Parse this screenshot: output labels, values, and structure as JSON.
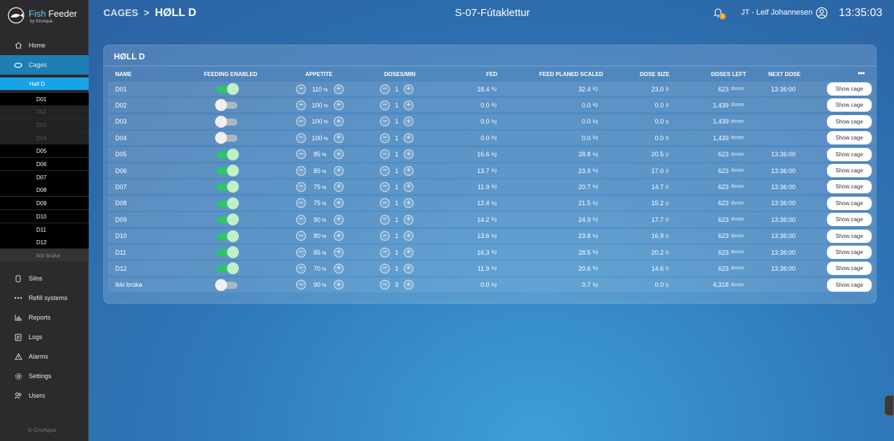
{
  "app": {
    "brand_fish": "Fish",
    "brand_feeder": "Feeder",
    "brand_by": "by GroAqua",
    "copyright": "© GroAqua"
  },
  "nav": {
    "home": "Home",
    "cages": "Cages",
    "silos": "Silos",
    "refill": "Refill systems",
    "reports": "Reports",
    "logs": "Logs",
    "alarms": "Alarms",
    "settings": "Settings",
    "users": "Users"
  },
  "cage_groups": {
    "selected": "Høll D",
    "items": [
      "D01",
      "D02",
      "D03",
      "D04",
      "D05",
      "D06",
      "D07",
      "D08",
      "D09",
      "D10",
      "D11",
      "D12",
      "Ikki brúka"
    ]
  },
  "header": {
    "crumb_root": "CAGES",
    "crumb_sep": ">",
    "crumb_current": "HØLL D",
    "title": "S-07-Fútaklettur",
    "notifications": "1",
    "user": "JT - Leif Johannesen",
    "time": "13:35:03"
  },
  "table": {
    "title": "HØLL D",
    "columns": {
      "name": "NAME",
      "feeding": "FEEDING ENABLED",
      "appetite": "APPETITE",
      "doses_min": "DOSES/MIN",
      "fed": "FED",
      "feed_planed": "FEED PLANED SCALED",
      "dose_size": "DOSE SIZE",
      "doses_left": "DOSES LEFT",
      "next_dose": "NEXT DOSE"
    },
    "units": {
      "percent": "%",
      "kg": "kg",
      "g": "g",
      "doses": "doses"
    },
    "button_label": "Show cage",
    "rows": [
      {
        "name": "D01",
        "enabled": true,
        "appetite": "110",
        "doses_min": "1",
        "fed": "18.4",
        "planed": "32.4",
        "dose_size": "23.0",
        "doses_left": "623",
        "next": "13:36:00"
      },
      {
        "name": "D02",
        "enabled": false,
        "appetite": "100",
        "doses_min": "1",
        "fed": "0.0",
        "planed": "0.0",
        "dose_size": "0.0",
        "doses_left": "1,439",
        "next": ""
      },
      {
        "name": "D03",
        "enabled": false,
        "appetite": "100",
        "doses_min": "1",
        "fed": "0.0",
        "planed": "0.0",
        "dose_size": "0.0",
        "doses_left": "1,439",
        "next": ""
      },
      {
        "name": "D04",
        "enabled": false,
        "appetite": "100",
        "doses_min": "1",
        "fed": "0.0",
        "planed": "0.0",
        "dose_size": "0.0",
        "doses_left": "1,439",
        "next": ""
      },
      {
        "name": "D05",
        "enabled": true,
        "appetite": "85",
        "doses_min": "1",
        "fed": "16.6",
        "planed": "28.8",
        "dose_size": "20.5",
        "doses_left": "623",
        "next": "13:36:00"
      },
      {
        "name": "D06",
        "enabled": true,
        "appetite": "85",
        "doses_min": "1",
        "fed": "13.7",
        "planed": "23.9",
        "dose_size": "17.0",
        "doses_left": "623",
        "next": "13:36:00"
      },
      {
        "name": "D07",
        "enabled": true,
        "appetite": "75",
        "doses_min": "1",
        "fed": "11.9",
        "planed": "20.7",
        "dose_size": "14.7",
        "doses_left": "623",
        "next": "13:36:00"
      },
      {
        "name": "D08",
        "enabled": true,
        "appetite": "75",
        "doses_min": "1",
        "fed": "12.4",
        "planed": "21.5",
        "dose_size": "15.2",
        "doses_left": "623",
        "next": "13:36:00"
      },
      {
        "name": "D09",
        "enabled": true,
        "appetite": "90",
        "doses_min": "1",
        "fed": "14.2",
        "planed": "24.9",
        "dose_size": "17.7",
        "doses_left": "623",
        "next": "13:36:00"
      },
      {
        "name": "D10",
        "enabled": true,
        "appetite": "80",
        "doses_min": "1",
        "fed": "13.6",
        "planed": "23.8",
        "dose_size": "16.9",
        "doses_left": "623",
        "next": "13:36:00"
      },
      {
        "name": "D11",
        "enabled": true,
        "appetite": "85",
        "doses_min": "1",
        "fed": "16.3",
        "planed": "28.5",
        "dose_size": "20.2",
        "doses_left": "623",
        "next": "13:36:00"
      },
      {
        "name": "D12",
        "enabled": true,
        "appetite": "70",
        "doses_min": "1",
        "fed": "11.9",
        "planed": "20.6",
        "dose_size": "14.6",
        "doses_left": "623",
        "next": "13:36:00"
      },
      {
        "name": "Ikki brúka",
        "enabled": false,
        "appetite": "90",
        "doses_min": "3",
        "fed": "0.0",
        "planed": "0.7",
        "dose_size": "0.0",
        "doses_left": "4,318",
        "next": ""
      }
    ]
  }
}
